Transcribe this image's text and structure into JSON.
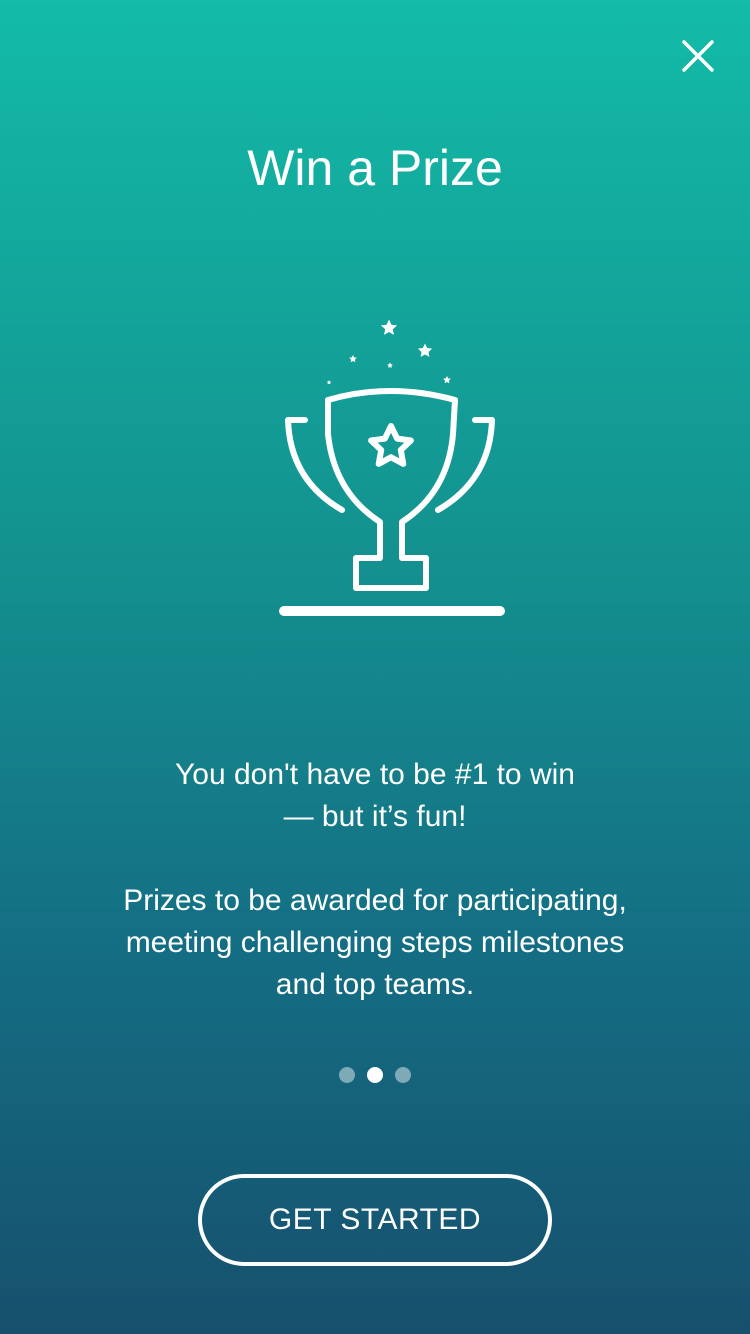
{
  "header": {
    "close_icon": "close-icon"
  },
  "content": {
    "title": "Win a Prize",
    "illustration_icon": "trophy-icon",
    "tagline_line1": "You don't have to be #1 to win",
    "tagline_line2": "— but it’s fun!",
    "description_line1": "Prizes to be awarded for participating,",
    "description_line2": "meeting challenging steps milestones",
    "description_line3": "and top teams."
  },
  "pager": {
    "page_count": 3,
    "active_page": 2
  },
  "footer": {
    "cta_label": "GET STARTED"
  },
  "colors": {
    "gradient_top": "#13bba8",
    "gradient_bottom": "#16506d",
    "foreground": "#ffffff"
  }
}
